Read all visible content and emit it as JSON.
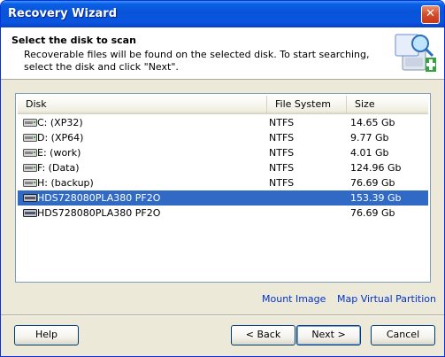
{
  "window": {
    "title": "Recovery Wizard",
    "close_glyph": "✕"
  },
  "header": {
    "title": "Select the disk to scan",
    "description": "Recoverable files will be found on the selected disk. To start searching, select the disk and click \"Next\".",
    "icon": "disk-magnifier-icon"
  },
  "disk_list": {
    "columns": [
      "Disk",
      "File System",
      "Size"
    ],
    "rows": [
      {
        "disk": "C: (XP32)",
        "fs": "NTFS",
        "size": "14.65 Gb",
        "type": "partition"
      },
      {
        "disk": "D: (XP64)",
        "fs": "NTFS",
        "size": "9.77 Gb",
        "type": "partition"
      },
      {
        "disk": "E: (work)",
        "fs": "NTFS",
        "size": "4.01 Gb",
        "type": "partition"
      },
      {
        "disk": "F: (Data)",
        "fs": "NTFS",
        "size": "124.96 Gb",
        "type": "partition"
      },
      {
        "disk": "H: (backup)",
        "fs": "NTFS",
        "size": "76.69 Gb",
        "type": "partition"
      },
      {
        "disk": "HDS728080PLA380 PF2O",
        "fs": "",
        "size": "153.39 Gb",
        "type": "physical",
        "selected": true
      },
      {
        "disk": "HDS728080PLA380 PF2O",
        "fs": "",
        "size": "76.69 Gb",
        "type": "physical"
      }
    ]
  },
  "links": {
    "mount_image": "Mount Image",
    "map_virtual_partition": "Map Virtual Partition"
  },
  "buttons": {
    "help": "Help",
    "back": "< Back",
    "next": "Next >",
    "cancel": "Cancel"
  },
  "colors": {
    "selection": "#316ac5",
    "titlebar": "#0853d8",
    "link": "#0033cc"
  }
}
